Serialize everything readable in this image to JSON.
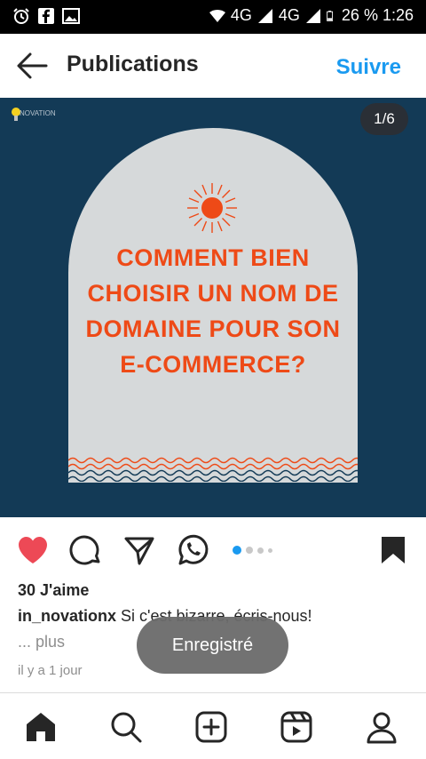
{
  "status_bar": {
    "network_1": "4G",
    "network_2": "4G",
    "battery": "26 %",
    "time": "1:26"
  },
  "header": {
    "title": "Publications",
    "follow_label": "Suivre"
  },
  "post": {
    "brand_logo_text": "NOVATION",
    "image_counter": "1/6",
    "headline": [
      "COMMENT BIEN",
      "CHOISIR UN NOM DE",
      "DOMAINE POUR SON",
      "E-COMMERCE?"
    ],
    "carousel_dots": 4,
    "carousel_active_index": 0,
    "liked": true,
    "likes": "30 J'aime",
    "username": "in_novationx",
    "caption": "Si c'est bizarre, écris-nous!",
    "more_label": "... plus",
    "time_ago": "il y a 1 jour"
  },
  "toast": {
    "text": "Enregistré"
  },
  "colors": {
    "accent": "#1a9af0",
    "post_background": "#133a56",
    "arch": "#d6d9da",
    "headline": "#ee4a17",
    "like": "#ed4956"
  }
}
